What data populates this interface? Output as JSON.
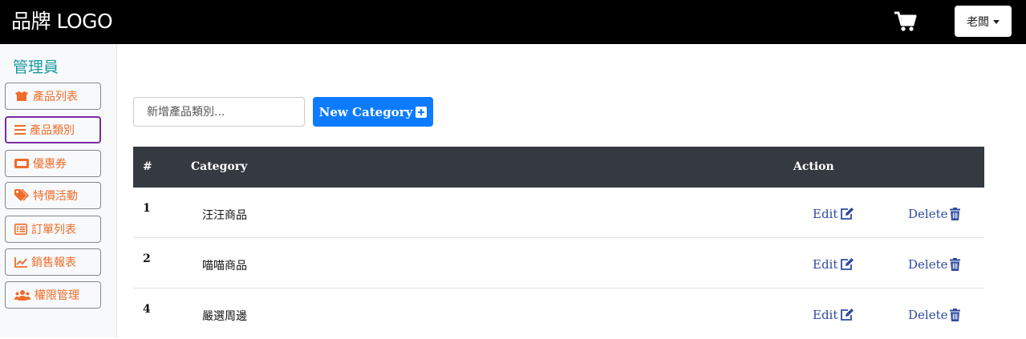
{
  "navbar": {
    "brand": "品牌 LOGO",
    "cart_icon": "cart-icon",
    "user_menu_label": "老闆"
  },
  "sidebar": {
    "title": "管理員",
    "active_index": 1,
    "items": [
      {
        "label": "產品列表",
        "icon": "box-open-icon"
      },
      {
        "label": "產品類別",
        "icon": "list-icon"
      },
      {
        "label": "優惠券",
        "icon": "ticket-icon"
      },
      {
        "label": "特價活動",
        "icon": "tags-icon"
      },
      {
        "label": "訂單列表",
        "icon": "list-alt-icon"
      },
      {
        "label": "銷售報表",
        "icon": "chart-line-icon"
      },
      {
        "label": "權限管理",
        "icon": "users-icon"
      }
    ]
  },
  "form": {
    "input_placeholder": "新增產品類別...",
    "new_button_label": "New Category"
  },
  "table": {
    "headers": {
      "num": "#",
      "category": "Category",
      "action": "Action"
    },
    "rows": [
      {
        "num": "1",
        "name": "汪汪商品",
        "edit": "Edit",
        "delete": "Delete"
      },
      {
        "num": "2",
        "name": "喵喵商品",
        "edit": "Edit",
        "delete": "Delete"
      },
      {
        "num": "4",
        "name": "嚴選周邊",
        "edit": "Edit",
        "delete": "Delete"
      }
    ]
  },
  "colors": {
    "accent": "#ee6d2a",
    "primary": "#0d7bff",
    "link": "#2f4aa0",
    "header_dark": "#343a40",
    "title": "#1a9aa0"
  }
}
